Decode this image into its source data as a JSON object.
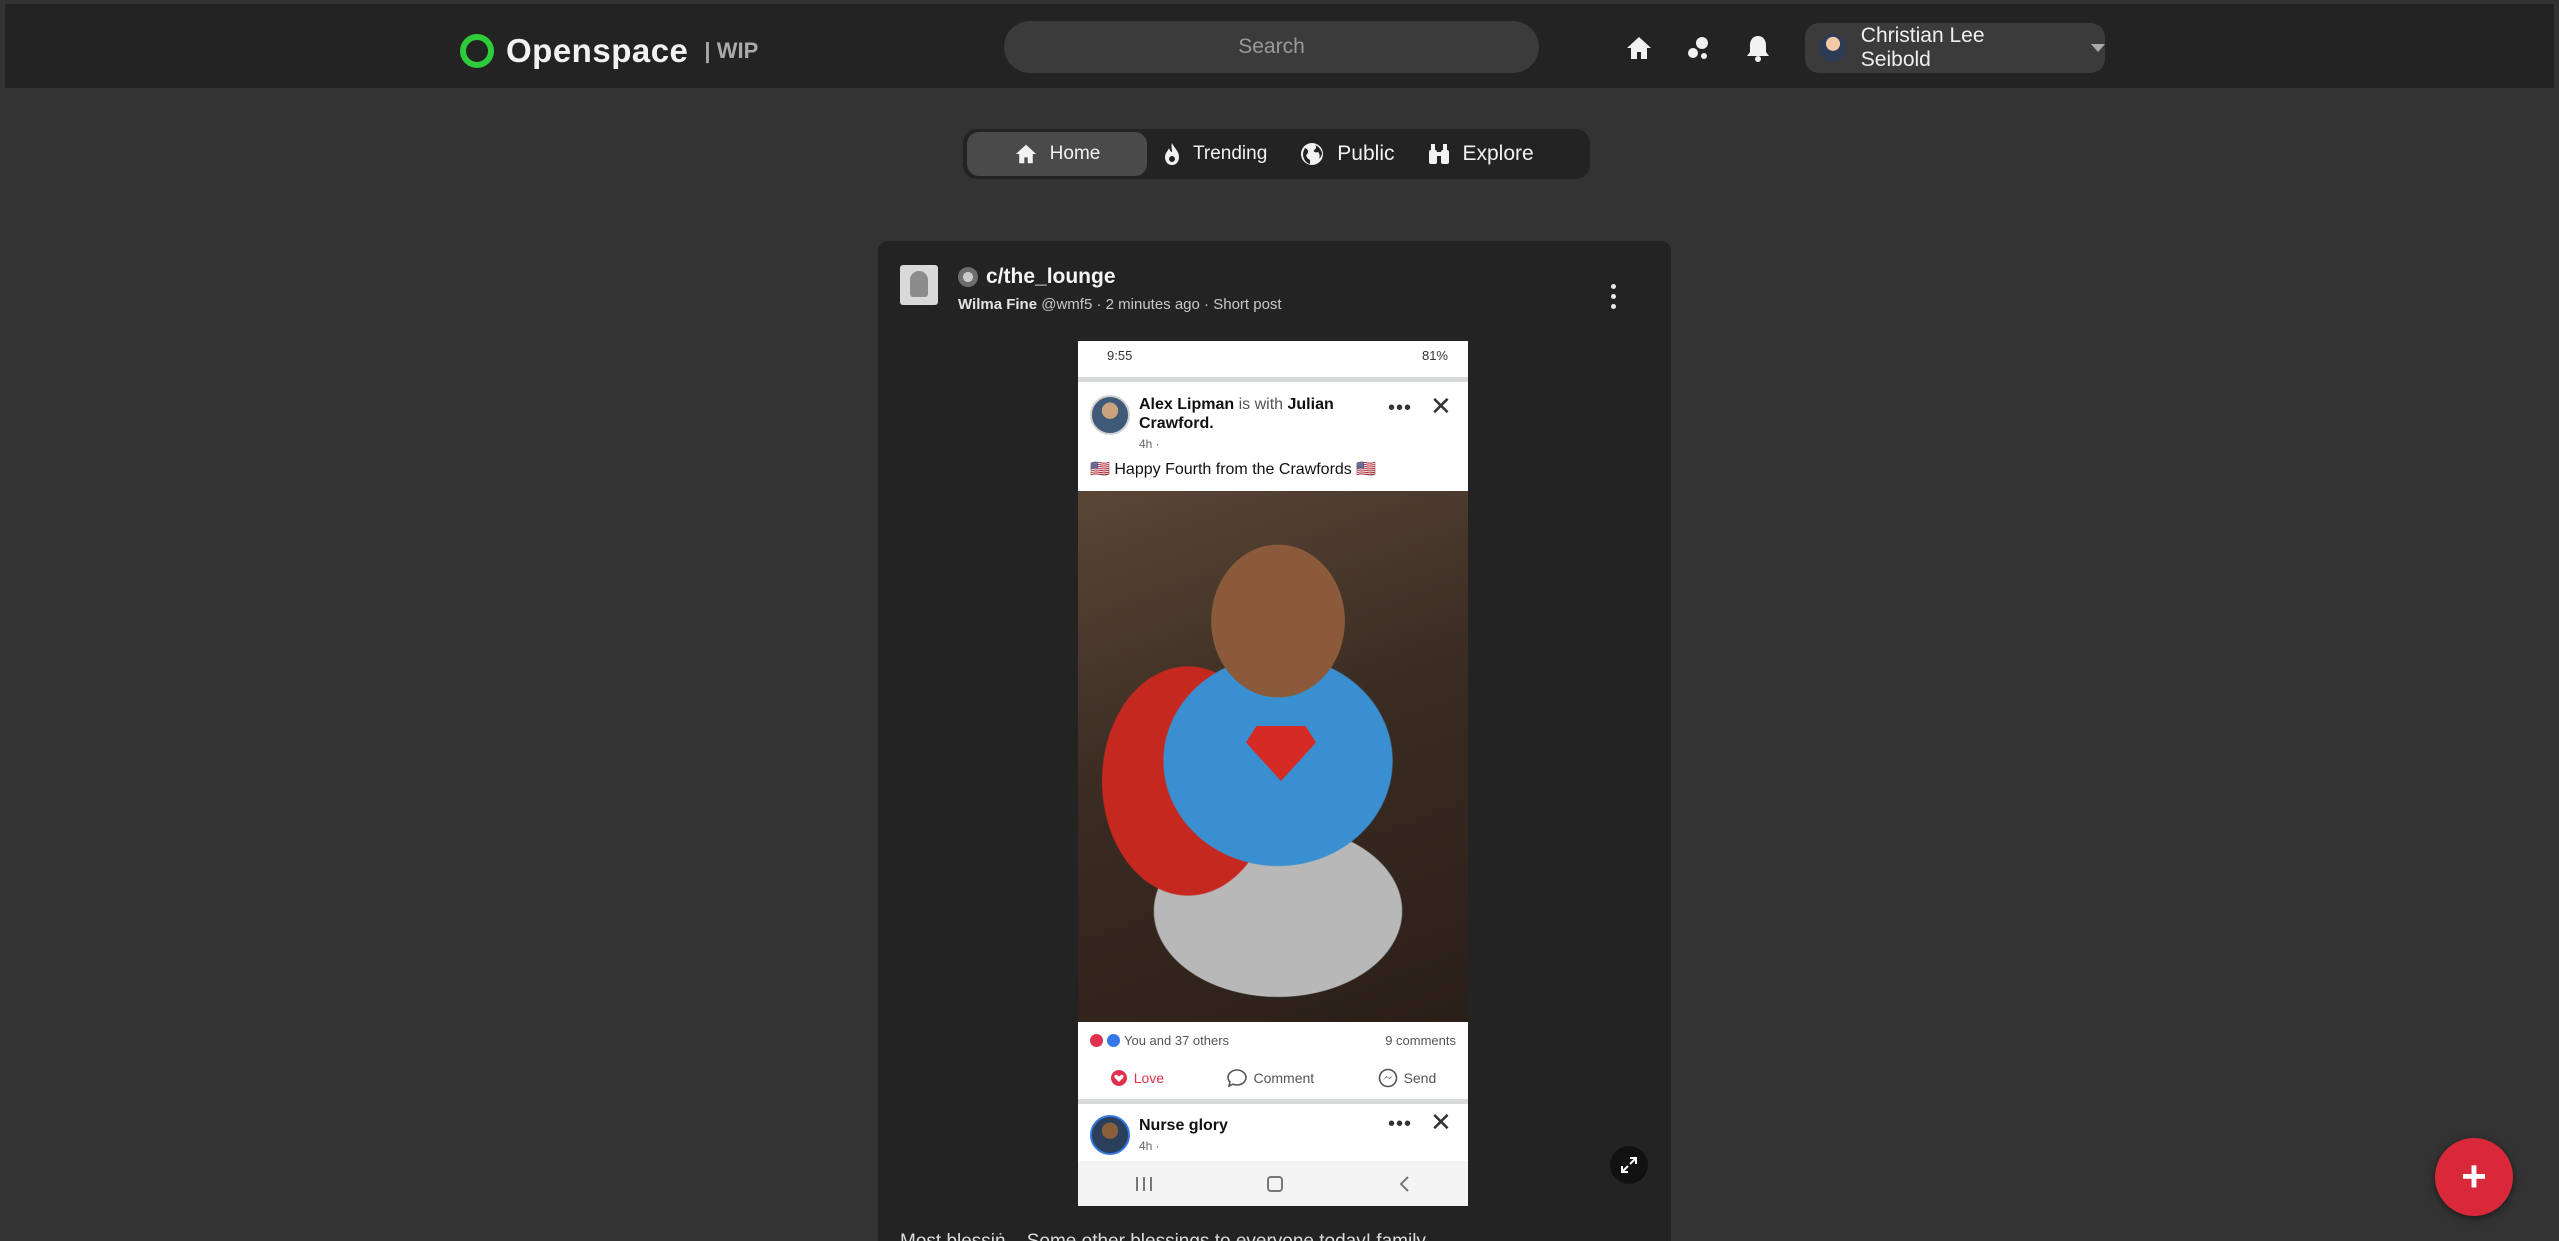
{
  "app": {
    "name": "Openspace",
    "tag": "| WIP",
    "accent": "#2ecc3a"
  },
  "header": {
    "search_placeholder": "Search",
    "icons": [
      "home-icon",
      "bubbles-icon",
      "bell-icon"
    ],
    "user_name": "Christian Lee Seibold"
  },
  "tabs": [
    {
      "label": "Home",
      "icon": "home-icon",
      "active": true
    },
    {
      "label": "Trending",
      "icon": "flame-icon",
      "active": false
    },
    {
      "label": "Public",
      "icon": "globe-icon",
      "active": false
    },
    {
      "label": "Explore",
      "icon": "binoculars-icon",
      "active": false
    }
  ],
  "post": {
    "community": "c/the_lounge",
    "author_name": "Wilma Fine",
    "author_handle": "@wmf5",
    "time": "2 minutes ago",
    "post_type": "Short post",
    "separator": "·",
    "body_preview": "Most blessiṅ... Some other blessings to everyone today! family"
  },
  "screenshot": {
    "status_time": "9:55",
    "status_right": "81%",
    "fb_author": "Alex Lipman",
    "fb_with_text": "is with",
    "fb_with_name": "Julian Crawford.",
    "fb_time": "4h ·",
    "fb_caption": "🇺🇸 Happy Fourth from the Crawfords 🇺🇸",
    "reactions_text": "You and 37 others",
    "comments_count": "9 comments",
    "actions": {
      "love": "Love",
      "comment": "Comment",
      "send": "Send"
    },
    "second_author": "Nurse glory",
    "second_time": "4h ·",
    "dots": "•••",
    "close": "✕"
  },
  "fab_label": "+"
}
